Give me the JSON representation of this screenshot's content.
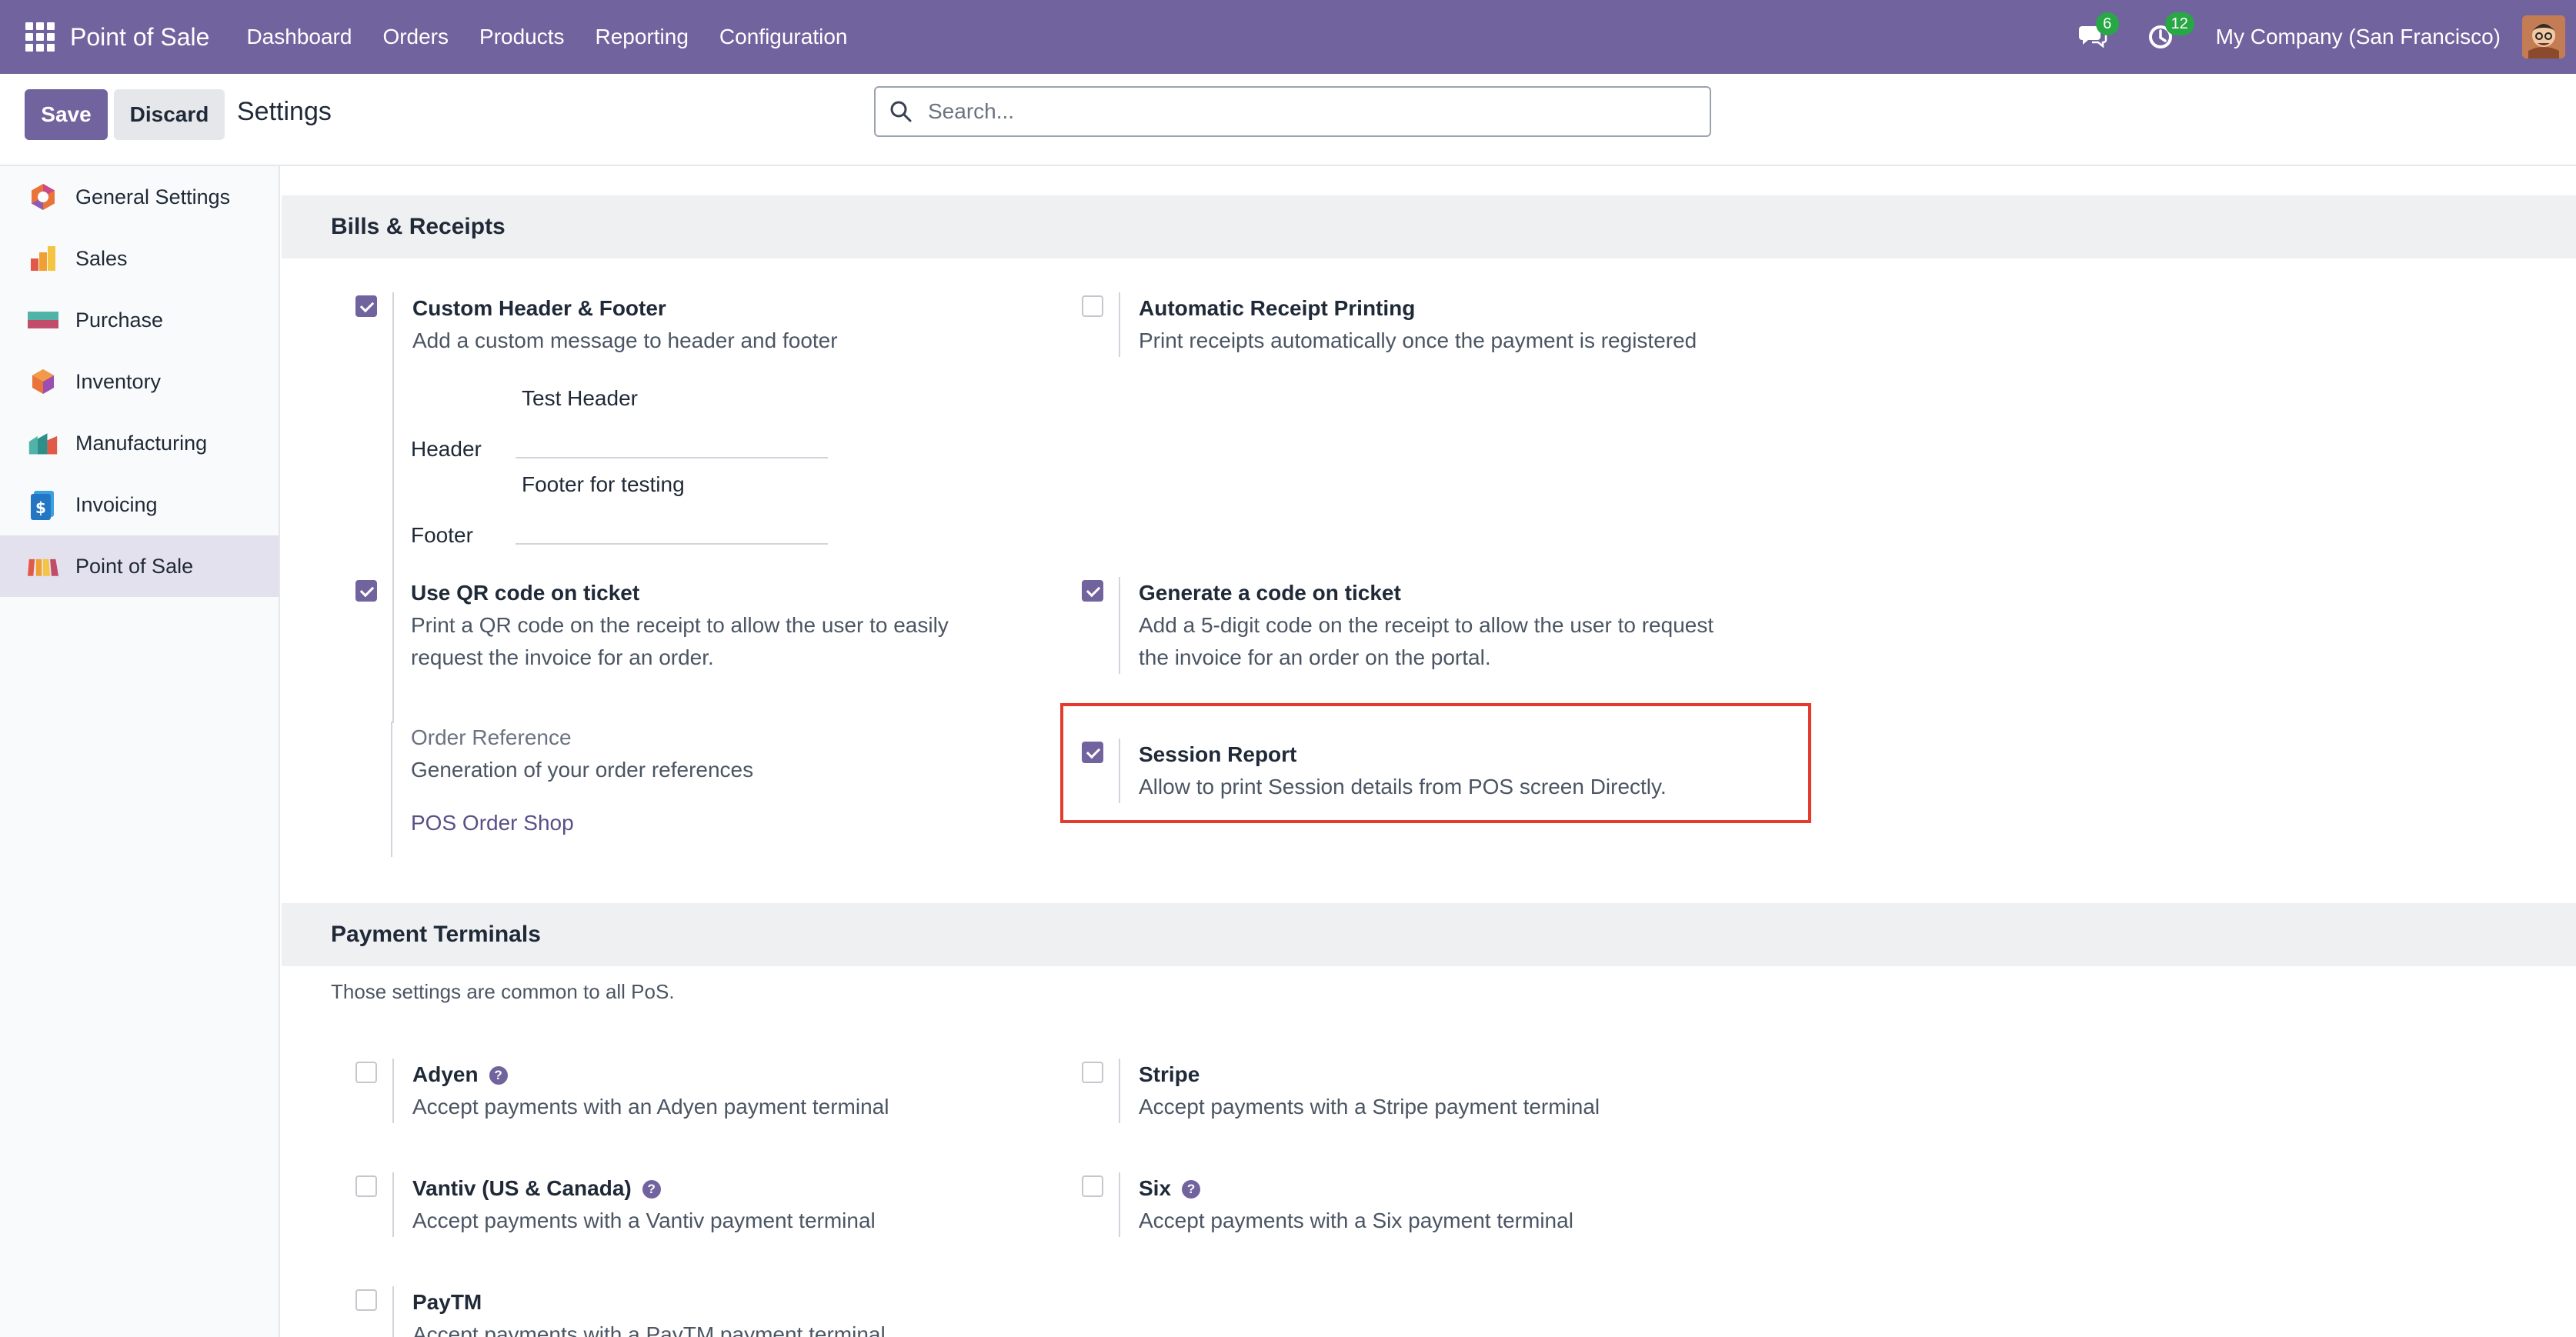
{
  "navbar": {
    "app_title": "Point of Sale",
    "menu": [
      "Dashboard",
      "Orders",
      "Products",
      "Reporting",
      "Configuration"
    ],
    "messages_count": "6",
    "activities_count": "12",
    "company": "My Company (San Francisco)"
  },
  "control": {
    "save_label": "Save",
    "discard_label": "Discard",
    "title": "Settings",
    "search_placeholder": "Search..."
  },
  "sidebar": {
    "items": [
      {
        "label": "General Settings",
        "icon": "general-settings-icon"
      },
      {
        "label": "Sales",
        "icon": "sales-icon"
      },
      {
        "label": "Purchase",
        "icon": "purchase-icon"
      },
      {
        "label": "Inventory",
        "icon": "inventory-icon"
      },
      {
        "label": "Manufacturing",
        "icon": "manufacturing-icon"
      },
      {
        "label": "Invoicing",
        "icon": "invoicing-icon"
      },
      {
        "label": "Point of Sale",
        "icon": "point-of-sale-icon",
        "active": true
      }
    ]
  },
  "bills": {
    "title": "Bills & Receipts",
    "custom_header": {
      "title": "Custom Header & Footer",
      "desc": "Add a custom message to header and footer",
      "checked": true
    },
    "header_label": "Header",
    "header_value": "Test Header",
    "footer_label": "Footer",
    "footer_value": "Footer for testing",
    "auto_print": {
      "title": "Automatic Receipt Printing",
      "desc": "Print receipts automatically once the payment is registered",
      "checked": false
    },
    "qr_code": {
      "title": "Use QR code on ticket",
      "desc1": "Print a QR code on the receipt to allow the user to easily",
      "desc2": "request the invoice for an order.",
      "checked": true
    },
    "gen_code": {
      "title": "Generate a code on ticket",
      "desc1": "Add a 5-digit code on the receipt to allow the user to request",
      "desc2": "the invoice for an order on the portal.",
      "checked": true
    },
    "order_ref": {
      "title": "Order Reference",
      "desc": "Generation of your order references",
      "link": "POS Order Shop"
    },
    "session_report": {
      "title": "Session Report",
      "desc": "Allow to print Session details from POS screen Directly.",
      "checked": true
    }
  },
  "payment": {
    "title": "Payment Terminals",
    "note": "Those settings are common to all PoS.",
    "adyen": {
      "title": "Adyen",
      "desc": "Accept payments with an Adyen payment terminal"
    },
    "stripe": {
      "title": "Stripe",
      "desc": "Accept payments with a Stripe payment terminal"
    },
    "vantiv": {
      "title": "Vantiv (US & Canada)",
      "desc": "Accept payments with a Vantiv payment terminal"
    },
    "six": {
      "title": "Six",
      "desc": "Accept payments with a Six payment terminal"
    },
    "paytm": {
      "title": "PayTM",
      "desc": "Accept payments with a PayTM payment terminal"
    }
  },
  "colors": {
    "brand": "#71639e",
    "highlight": "#e53b2d",
    "badge": "#28a745"
  }
}
